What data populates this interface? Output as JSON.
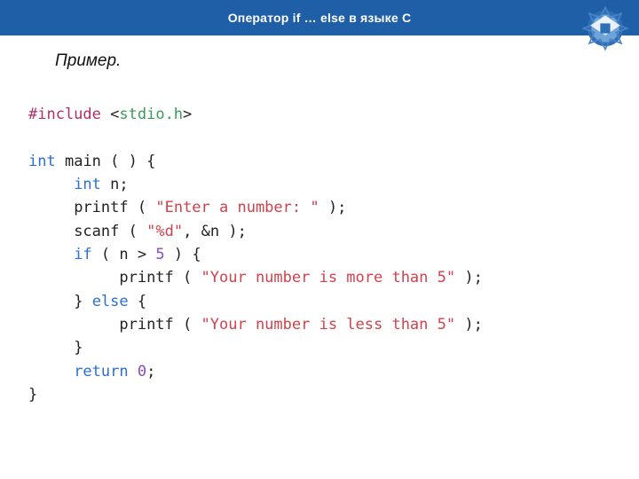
{
  "header": {
    "title": "Оператор if … else в языке С"
  },
  "subtitle": "Пример.",
  "code": {
    "include": "#include",
    "stdio": "stdio.h",
    "kw_int": "int",
    "main": "main",
    "lparen": "(",
    "rparen": ")",
    "lbrace": "{",
    "rbrace": "}",
    "var_n": "n",
    "semi": ";",
    "printf": "printf",
    "scanf": "scanf",
    "str_prompt": "\"Enter a number: \"",
    "str_fmt": "\"%d\"",
    "amp_n": "&n",
    "kw_if": "if",
    "gt": ">",
    "five": "5",
    "str_more": "\"Your number is more than 5\"",
    "kw_else": "else",
    "str_less": "\"Your number is less than 5\"",
    "kw_return": "return",
    "zero": "0",
    "lt": "<",
    "gt2": ">",
    "comma": ","
  }
}
